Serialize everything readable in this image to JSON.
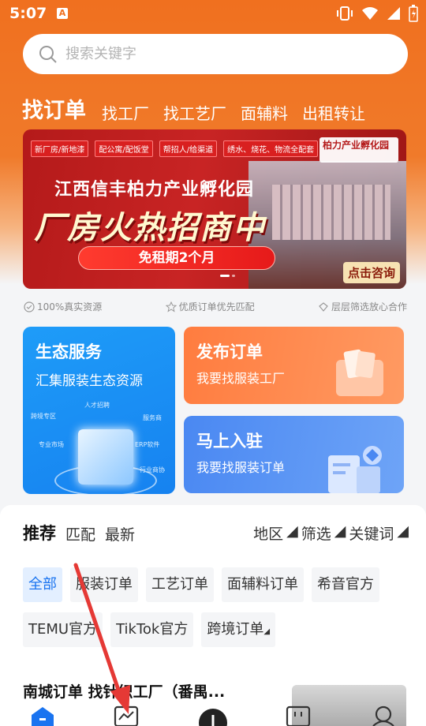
{
  "status_bar": {
    "time": "5:07",
    "app_badge": "A"
  },
  "search": {
    "placeholder": "搜索关键字"
  },
  "top_tabs": [
    {
      "label": "找订单",
      "active": true
    },
    {
      "label": "找工厂"
    },
    {
      "label": "找工艺厂"
    },
    {
      "label": "面辅料"
    },
    {
      "label": "出租转让"
    }
  ],
  "banner": {
    "tags": [
      "新厂房/新地漆",
      "配公寓/配饭堂",
      "帮招人/给渠道",
      "绣水、烧花、物流全配套"
    ],
    "brand_name": "柏力产业孵化园",
    "subtitle": "江西信丰柏力产业孵化园",
    "title": "厂房火热招商中",
    "pill": "免租期2个月",
    "consult_button": "点击咨询"
  },
  "features": [
    "100%真实资源",
    "优质订单优先匹配",
    "层层筛选放心合作"
  ],
  "cards": {
    "ecology": {
      "title": "生态服务",
      "subtitle": "汇集服装生态资源",
      "labels": [
        "人才招聘",
        "跨境专区",
        "服务商",
        "专业市场",
        "ERP软件",
        "行业商协"
      ]
    },
    "publish": {
      "title": "发布订单",
      "subtitle": "我要找服装工厂"
    },
    "join": {
      "title": "马上入驻",
      "subtitle": "我要找服装订单"
    }
  },
  "sub_tabs": [
    {
      "label": "推荐",
      "active": true
    },
    {
      "label": "匹配"
    },
    {
      "label": "最新"
    }
  ],
  "filters": [
    "地区",
    "筛选",
    "关键词"
  ],
  "chips": [
    {
      "label": "全部",
      "active": true
    },
    {
      "label": "服装订单"
    },
    {
      "label": "工艺订单"
    },
    {
      "label": "面辅料订单"
    },
    {
      "label": "希音官方"
    },
    {
      "label": "TEMU官方"
    },
    {
      "label": "TikTok官方"
    },
    {
      "label": "跨境订单"
    }
  ],
  "list_item_title": "南城订单 找针织工厂（番禺...",
  "colors": {
    "primary_orange": "#f0701f",
    "accent_blue": "#1a74f0",
    "annotation_red": "#e53935"
  },
  "icons": [
    "search-icon",
    "vibrate-icon",
    "wifi-icon",
    "battery-icon",
    "home-icon",
    "chart-icon",
    "add-icon",
    "store-icon",
    "user-icon"
  ]
}
